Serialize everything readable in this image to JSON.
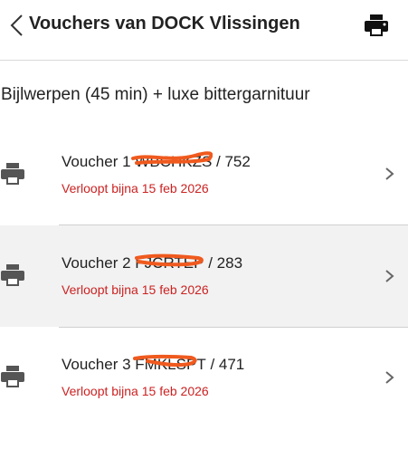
{
  "header": {
    "title": "Vouchers van DOCK Vlissingen",
    "back_icon": "chevron-left-icon",
    "print_icon": "printer-icon"
  },
  "product": {
    "name": "Bijlwerpen (45 min) + luxe bittergarnituur"
  },
  "vouchers": [
    {
      "prefix": "Voucher 1",
      "code_redacted": "WBCHKZS",
      "suffix": "/ 752",
      "expiry": "Verloopt bijna 15 feb 2026"
    },
    {
      "prefix": "Voucher 2",
      "code_redacted": "FJCRTEP",
      "suffix": "/ 283",
      "expiry": "Verloopt bijna 15 feb 2026"
    },
    {
      "prefix": "Voucher 3",
      "code_redacted": "FMKLSPT",
      "suffix": "/ 471",
      "expiry": "Verloopt bijna 15 feb 2026"
    }
  ],
  "colors": {
    "expiry": "#cc2222",
    "scribble": "#f05a1e",
    "selected_row": "#f2f2f2"
  }
}
